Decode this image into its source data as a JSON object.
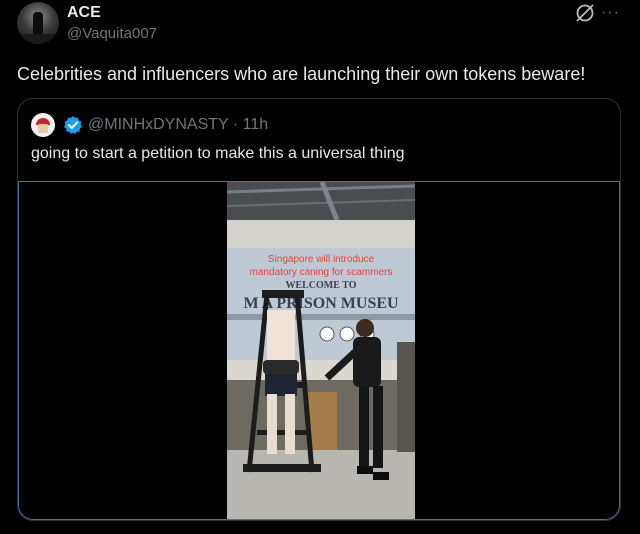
{
  "author": {
    "display_name": "ACE",
    "handle": "@Vaquita007"
  },
  "tweet": {
    "text": "Celebrities and influencers who are launching their own tokens beware!"
  },
  "quoted": {
    "handle_time": "@MINHxDYNASTY · 11h",
    "text": "going to start a petition to make this a universal thing",
    "video_caption_line1": "Singapore will introduce",
    "video_caption_line2": "mandatory caning for scammers",
    "sign_welcome": "WELCOME TO",
    "sign_museum": "M    A PRISON MUSEU"
  },
  "icons": {
    "grok": "grok-icon",
    "more": "more-icon",
    "verified": "verified-badge-icon"
  },
  "colors": {
    "background": "#000000",
    "text": "#e7e9ea",
    "muted": "#71767b",
    "verified_blue": "#1d9bf0",
    "caption_red": "#e8453c"
  }
}
